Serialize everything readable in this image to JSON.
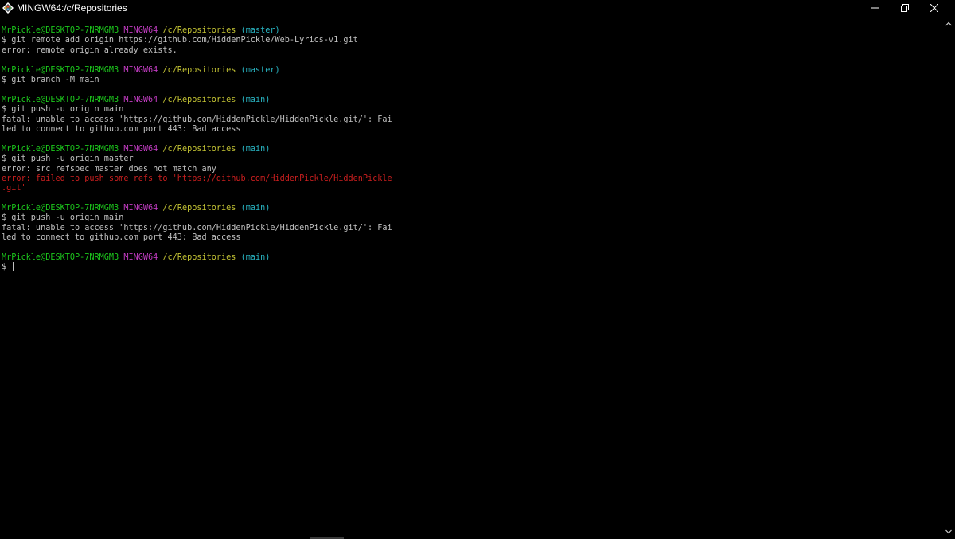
{
  "window": {
    "title": "MINGW64:/c/Repositories",
    "icon": "git-bash-icon"
  },
  "colors": {
    "background": "#000000",
    "text": "#c0c0c0",
    "user_host": "#1cc71c",
    "mingw": "#c23cc2",
    "path": "#c2c233",
    "branch": "#29b6c4",
    "error": "#cc1f1f"
  },
  "terminal": {
    "prompts": [
      {
        "user": "MrPickle@DESKTOP-7NRMGM3",
        "env": "MINGW64",
        "path": "/c/Repositories",
        "branch": "(master)"
      },
      {
        "user": "MrPickle@DESKTOP-7NRMGM3",
        "env": "MINGW64",
        "path": "/c/Repositories",
        "branch": "(master)"
      },
      {
        "user": "MrPickle@DESKTOP-7NRMGM3",
        "env": "MINGW64",
        "path": "/c/Repositories",
        "branch": "(main)"
      },
      {
        "user": "MrPickle@DESKTOP-7NRMGM3",
        "env": "MINGW64",
        "path": "/c/Repositories",
        "branch": "(main)"
      },
      {
        "user": "MrPickle@DESKTOP-7NRMGM3",
        "env": "MINGW64",
        "path": "/c/Repositories",
        "branch": "(main)"
      },
      {
        "user": "MrPickle@DESKTOP-7NRMGM3",
        "env": "MINGW64",
        "path": "/c/Repositories",
        "branch": "(main)"
      }
    ],
    "commands": [
      "$ git remote add origin https://github.com/HiddenPickle/Web-Lyrics-v1.git",
      "$ git branch -M main",
      "$ git push -u origin main",
      "$ git push -u origin master",
      "$ git push -u origin main",
      "$ "
    ],
    "outputs": {
      "remote_exists": "error: remote origin already exists.",
      "fatal1_a": "fatal: unable to access 'https://github.com/HiddenPickle/HiddenPickle.git/': Fai",
      "fatal1_b": "led to connect to github.com port 443: Bad access",
      "refspec": "error: src refspec master does not match any",
      "push_fail_a": "error: failed to push some refs to 'https://github.com/HiddenPickle/HiddenPickle",
      "push_fail_b": ".git'",
      "fatal2_a": "fatal: unable to access 'https://github.com/HiddenPickle/HiddenPickle.git/': Fai",
      "fatal2_b": "led to connect to github.com port 443: Bad access"
    }
  }
}
